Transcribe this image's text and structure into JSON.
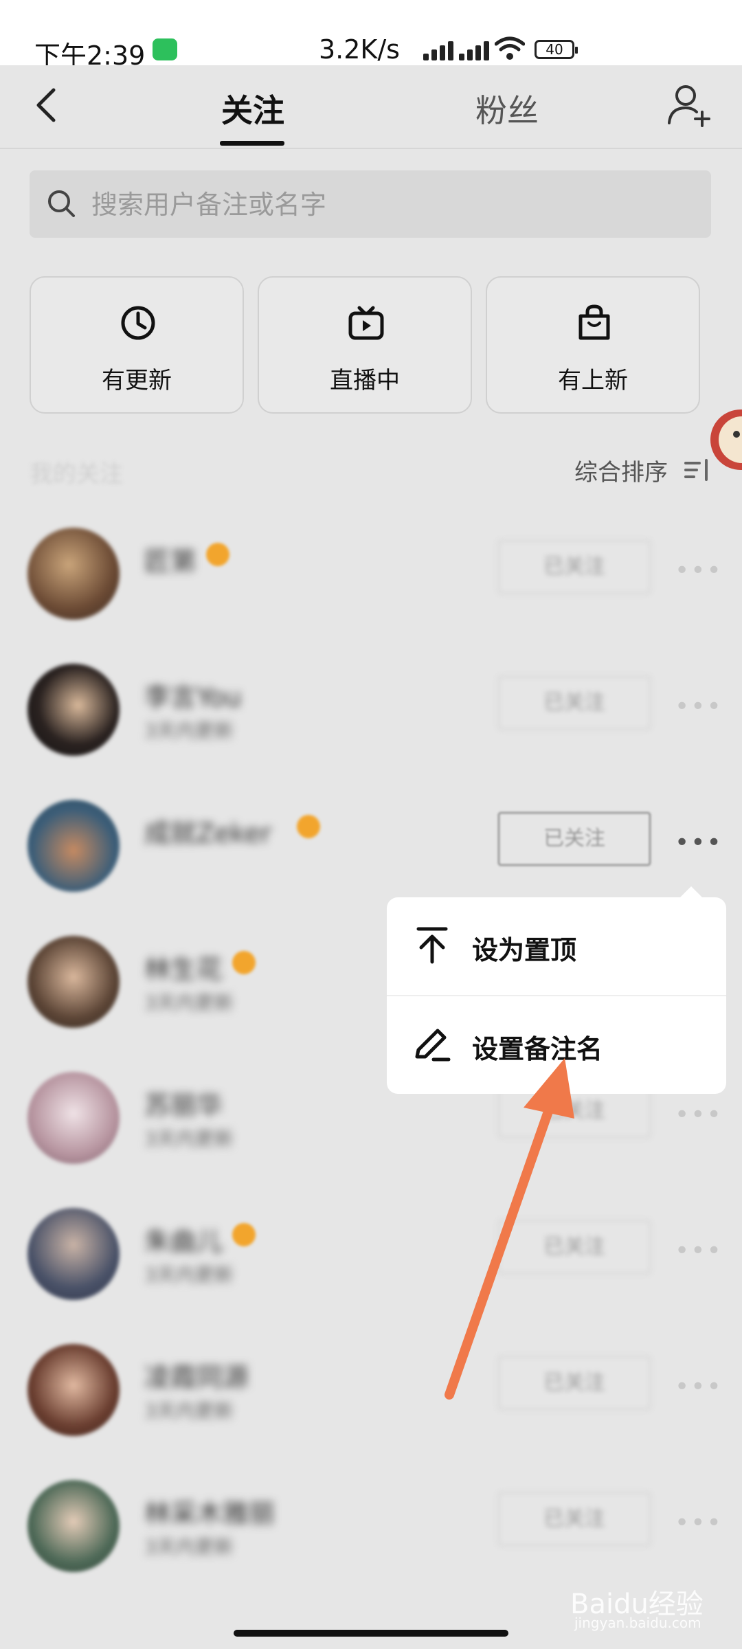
{
  "status_bar": {
    "time": "下午2:39",
    "network_speed": "3.2K/s",
    "battery": "40"
  },
  "header": {
    "tabs": [
      "关注",
      "粉丝"
    ],
    "active_tab": "关注"
  },
  "search": {
    "placeholder": "搜索用户备注或名字"
  },
  "filters": [
    {
      "label": "有更新",
      "icon": "clock-icon"
    },
    {
      "label": "直播中",
      "icon": "tv-play-icon"
    },
    {
      "label": "有上新",
      "icon": "shopping-bag-icon"
    }
  ],
  "section": {
    "title": "我的关注",
    "sort_label": "综合排序"
  },
  "users": [
    {
      "name": "匠第",
      "sub": "",
      "verified": true
    },
    {
      "name": "李言You",
      "sub": "3天内更新",
      "verified": false
    },
    {
      "name": "成就Zeker",
      "sub": "",
      "verified": true
    },
    {
      "name": "林生花",
      "sub": "3天内更新",
      "verified": true
    },
    {
      "name": "苏丽华",
      "sub": "3天内更新",
      "verified": false
    },
    {
      "name": "朱曲儿",
      "sub": "3天内更新",
      "verified": true
    },
    {
      "name": "凌霞同源",
      "sub": "3天内更新",
      "verified": false
    },
    {
      "name": "林采木雅丽",
      "sub": "3天内更新",
      "verified": false
    }
  ],
  "follow_button_label": "已关注",
  "menu": {
    "pin_label": "设为置顶",
    "remark_label": "设置备注名"
  },
  "watermark": {
    "brand": "Baidu经验",
    "url": "jingyan.baidu.com"
  },
  "colors": {
    "background": "#e6e6e6",
    "annotation_arrow": "#f0794a",
    "verified_badge": "#f2a52d",
    "wechat": "#2dc05c"
  }
}
